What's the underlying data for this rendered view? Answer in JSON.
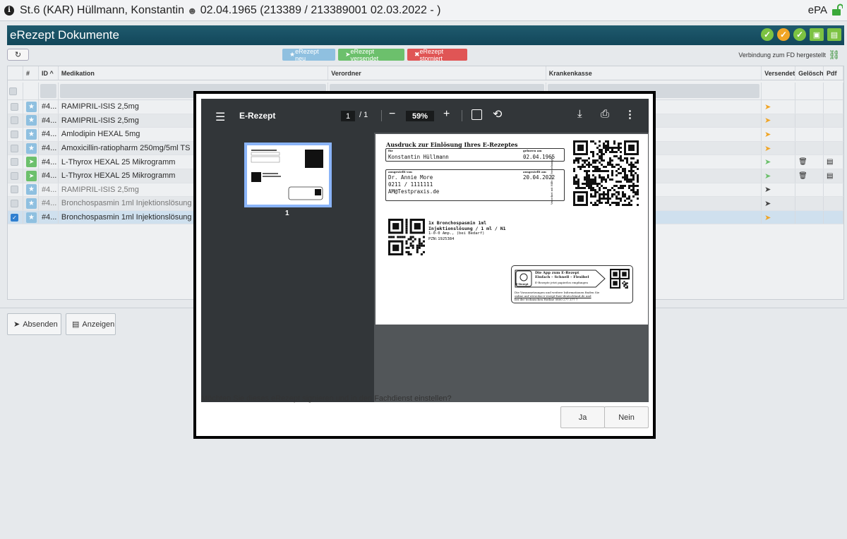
{
  "header": {
    "patient": "St.6 (KAR) Hüllmann, Konstantin",
    "patient_details": "02.04.1965 (213389 / 213389001 02.03.2022 - )",
    "epa_label": "ePA"
  },
  "section": {
    "title": "eRezept Dokumente"
  },
  "toolbar": {
    "filter_neu": "eRezept neu",
    "filter_versendet": "eRezept versendet",
    "filter_storniert": "eRezept storniert",
    "connection_status": "Verbindung zum FD hergestellt"
  },
  "grid": {
    "columns": {
      "hash": "#",
      "id": "ID ^",
      "medikation": "Medikation",
      "verordner": "Verordner",
      "krankenkasse": "Krankenkasse",
      "versendet": "Versendet",
      "geloescht": "Gelöscht",
      "pdf": "Pdf"
    },
    "rows": [
      {
        "id": "#4...",
        "med": "RAMIPRIL-ISIS 2,5mg"
      },
      {
        "id": "#4...",
        "med": "RAMIPRIL-ISIS 2,5mg"
      },
      {
        "id": "#4...",
        "med": "Amlodipin HEXAL 5mg"
      },
      {
        "id": "#4...",
        "med": "Amoxicillin-ratiopharm 250mg/5ml TS"
      },
      {
        "id": "#4...",
        "med": "L-Thyrox HEXAL 25 Mikrogramm"
      },
      {
        "id": "#4...",
        "med": "L-Thyrox HEXAL 25 Mikrogramm"
      },
      {
        "id": "#4...",
        "med": "RAMIPRIL-ISIS 2,5mg"
      },
      {
        "id": "#4...",
        "med": "Bronchospasmin 1ml Injektionslösung"
      },
      {
        "id": "#4...",
        "med": "Bronchospasmin 1ml Injektionslösung"
      }
    ]
  },
  "actions": {
    "absenden": "Absenden",
    "anzeigen": "Anzeigen"
  },
  "pdf": {
    "title": "E-Rezept",
    "page_current": "1",
    "page_total": "/ 1",
    "zoom": "59%",
    "thumb_page": "1",
    "doc": {
      "heading": "Ausdruck zur Einlösung Ihres E-Rezeptes",
      "label_fuer": "für",
      "label_geboren": "geboren am",
      "patient": "Konstantin Hüllmann",
      "birthdate": "02.04.1965",
      "label_ausgestellt_von": "ausgestellt von",
      "label_ausgestellt_am": "ausgestellt am",
      "doctor": "Dr. Annie More",
      "phone": "0211 / 1111111",
      "email": "AM@Testpraxis.de",
      "issue_date": "20.04.2022",
      "side_note": "Verordnet mit Hilfe der Verordnungen",
      "med_line1": "1x Bronchospasmin 1ml",
      "med_line2": "Injektionslösung / 1 ml / N1",
      "dosage": "1-0-0 Amp., (bei Bedarf)",
      "pzn": "PZN:1925384",
      "app_title": "Die App zum E-Rezept",
      "app_sub": "Einfach – Schnell – Flexibel",
      "app_hint": "E-Rezepte jetzt papierlos empfangen",
      "app_logo": "E-Rezept",
      "info1": "Die Voraussetzungen und weitere Informationen finden Sie",
      "info2": "online auf www.das-e-rezept-fuer-deutschland.de und",
      "info3": "bei der technischen Hotline 0800 277 377 7"
    }
  },
  "dialog": {
    "question": "Möchten Sie dieses eRezept signieren und in den Fachdienst einstellen?",
    "yes": "Ja",
    "no": "Nein"
  }
}
